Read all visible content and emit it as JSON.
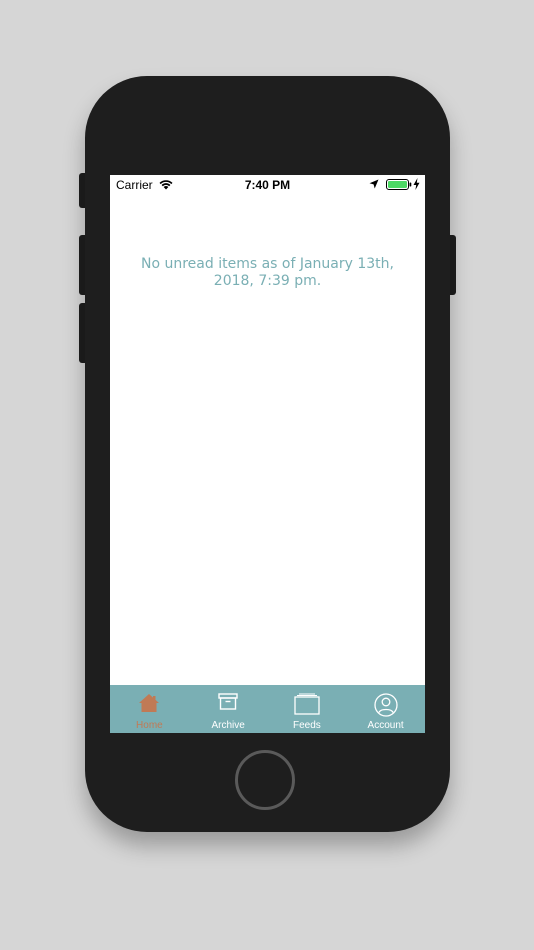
{
  "status_bar": {
    "carrier": "Carrier",
    "time": "7:40 PM",
    "icons": [
      "wifi-icon",
      "location-arrow-icon",
      "battery-icon",
      "charging-bolt-icon"
    ],
    "battery_color": "#4cd964"
  },
  "main": {
    "empty_message": "No unread items as of January 13th, 2018, 7:39 pm."
  },
  "tab_bar": {
    "background": "#7aafb4",
    "active_color": "#c07a55",
    "tabs": [
      {
        "label": "Home",
        "icon": "home-icon",
        "active": true
      },
      {
        "label": "Archive",
        "icon": "archive-box-icon",
        "active": false
      },
      {
        "label": "Feeds",
        "icon": "feeds-folder-icon",
        "active": false
      },
      {
        "label": "Account",
        "icon": "account-person-icon",
        "active": false
      }
    ]
  }
}
